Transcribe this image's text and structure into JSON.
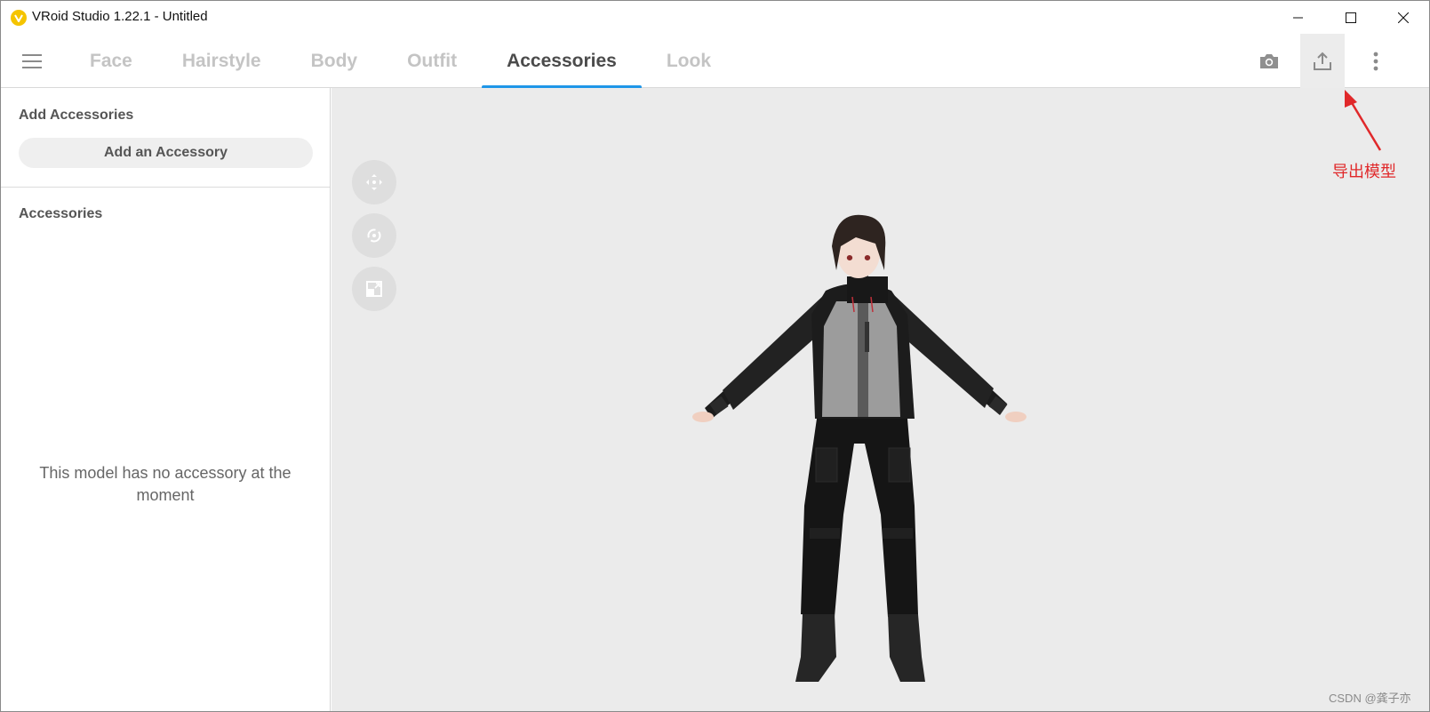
{
  "window": {
    "title": "VRoid Studio 1.22.1 - Untitled",
    "logo_icon": "vroid-logo-icon"
  },
  "window_controls": {
    "minimize_icon": "minimize-icon",
    "maximize_icon": "maximize-icon",
    "close_icon": "close-icon"
  },
  "nav": {
    "menu_icon": "hamburger-menu-icon",
    "tabs": [
      {
        "label": "Face",
        "active": false
      },
      {
        "label": "Hairstyle",
        "active": false
      },
      {
        "label": "Body",
        "active": false
      },
      {
        "label": "Outfit",
        "active": false
      },
      {
        "label": "Accessories",
        "active": true
      },
      {
        "label": "Look",
        "active": false
      }
    ],
    "tools": [
      "camera-icon",
      "export-icon",
      "more-vertical-icon"
    ]
  },
  "left_panel": {
    "add_section_title": "Add Accessories",
    "add_button_label": "Add an Accessory",
    "list_section_title": "Accessories",
    "empty_message": "This model has no accessory at the moment"
  },
  "viewport": {
    "controls": [
      "move-icon",
      "rotate-icon",
      "zoom-fit-icon"
    ],
    "model": "3D character model in T-pose (black and gray jacket, black cargo pants)"
  },
  "annotation": {
    "text": "导出模型",
    "color": "#e0282a"
  },
  "watermark": "CSDN @龚子亦",
  "colors": {
    "accent": "#1e96e8",
    "logo": "#f5c400",
    "viewport_bg": "#ebebeb"
  }
}
